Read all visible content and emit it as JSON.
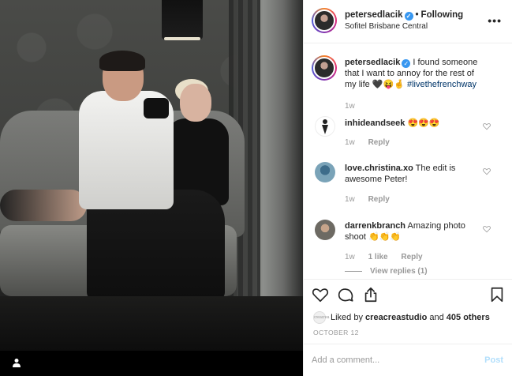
{
  "header": {
    "username": "petersedlacik",
    "separator": "•",
    "following_label": "Following",
    "location": "Sofitel Brisbane Central",
    "more_label": "•••"
  },
  "caption": {
    "username": "petersedlacik",
    "text": "I found someone that I want to annoy for the rest of my life 🖤😝🤞 ",
    "hashtag": "#livethefrenchway",
    "time": "1w"
  },
  "comments": [
    {
      "username": "inhideandseek",
      "text": "😍😍😍",
      "time": "1w",
      "reply_label": "Reply"
    },
    {
      "username": "love.christina.xo",
      "text": "The edit is awesome Peter!",
      "time": "1w",
      "reply_label": "Reply"
    },
    {
      "username": "darrenkbranch",
      "text": "Amazing photo shoot 👏👏👏",
      "time": "1w",
      "likes": "1 like",
      "reply_label": "Reply"
    }
  ],
  "view_replies": "View replies (1)",
  "likes": {
    "avatar_text": "creacrea",
    "prefix": "Liked by",
    "user": "creacreastudio",
    "middle": "and",
    "count": "405 others"
  },
  "date": "OCTOBER 12",
  "add_comment": {
    "placeholder": "Add a comment...",
    "post_label": "Post"
  },
  "colors": {
    "verified": "#3897f0",
    "hashtag": "#003569",
    "post_disabled": "#b2dffc",
    "muted": "#999999"
  },
  "icons": {
    "like": "heart-icon",
    "comment": "comment-icon",
    "share": "share-icon",
    "save": "bookmark-icon",
    "tag": "user-icon"
  }
}
